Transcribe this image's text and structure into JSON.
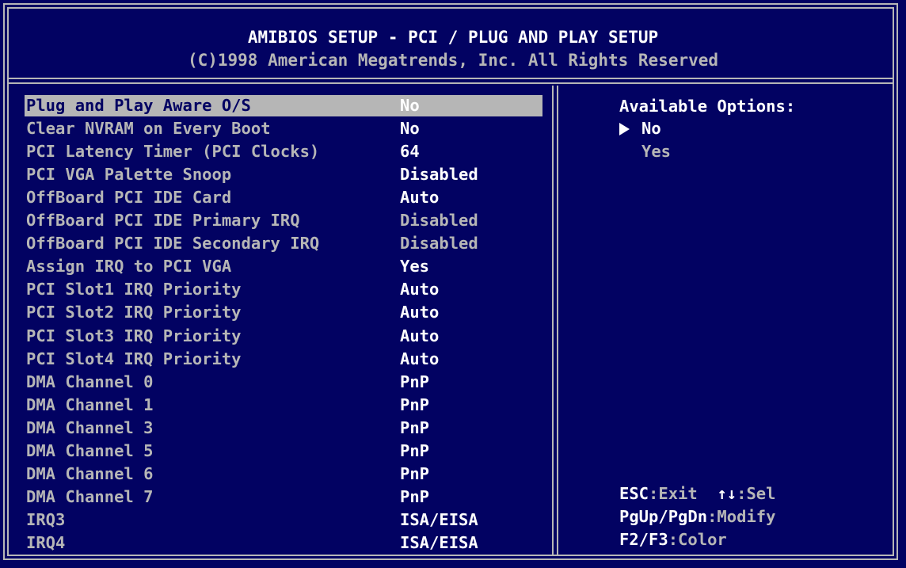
{
  "header": {
    "title": "AMIBIOS SETUP - PCI / PLUG AND PLAY SETUP",
    "copyright": "(C)1998 American Megatrends, Inc. All Rights Reserved"
  },
  "settings": [
    {
      "label": "Plug and Play Aware O/S",
      "value": "No"
    },
    {
      "label": "Clear NVRAM on Every Boot",
      "value": "No"
    },
    {
      "label": "PCI Latency Timer (PCI Clocks)",
      "value": "64"
    },
    {
      "label": "PCI VGA Palette Snoop",
      "value": "Disabled"
    },
    {
      "label": "OffBoard PCI IDE Card",
      "value": "Auto"
    },
    {
      "label": "OffBoard PCI IDE Primary IRQ",
      "value": "Disabled"
    },
    {
      "label": "OffBoard PCI IDE Secondary IRQ",
      "value": "Disabled"
    },
    {
      "label": "Assign IRQ to PCI VGA",
      "value": "Yes"
    },
    {
      "label": "PCI Slot1 IRQ Priority",
      "value": "Auto"
    },
    {
      "label": "PCI Slot2 IRQ Priority",
      "value": "Auto"
    },
    {
      "label": "PCI Slot3 IRQ Priority",
      "value": "Auto"
    },
    {
      "label": "PCI Slot4 IRQ Priority",
      "value": "Auto"
    },
    {
      "label": "DMA Channel 0",
      "value": "PnP"
    },
    {
      "label": "DMA Channel 1",
      "value": "PnP"
    },
    {
      "label": "DMA Channel 3",
      "value": "PnP"
    },
    {
      "label": "DMA Channel 5",
      "value": "PnP"
    },
    {
      "label": "DMA Channel 6",
      "value": "PnP"
    },
    {
      "label": "DMA Channel 7",
      "value": "PnP"
    },
    {
      "label": "IRQ3",
      "value": "ISA/EISA"
    },
    {
      "label": "IRQ4",
      "value": "ISA/EISA"
    }
  ],
  "options_panel": {
    "title": "Available Options:",
    "options": [
      "No",
      "Yes"
    ],
    "selected_index": 0
  },
  "help": [
    [
      {
        "key": "ESC",
        "desc": ":Exit  "
      },
      {
        "key": "↑↓",
        "desc": ":Sel"
      }
    ],
    [
      {
        "key": "PgUp/PgDn",
        "desc": ":Modify"
      }
    ],
    [
      {
        "key": "F2/F3",
        "desc": ":Color"
      }
    ]
  ],
  "colors": {
    "background": "#020262",
    "text_dim": "#b6b6b6",
    "text_bright": "#ffffff",
    "highlight": "#b6b6b6"
  },
  "icons": {
    "selected_option_marker": "triangle-right-icon"
  }
}
